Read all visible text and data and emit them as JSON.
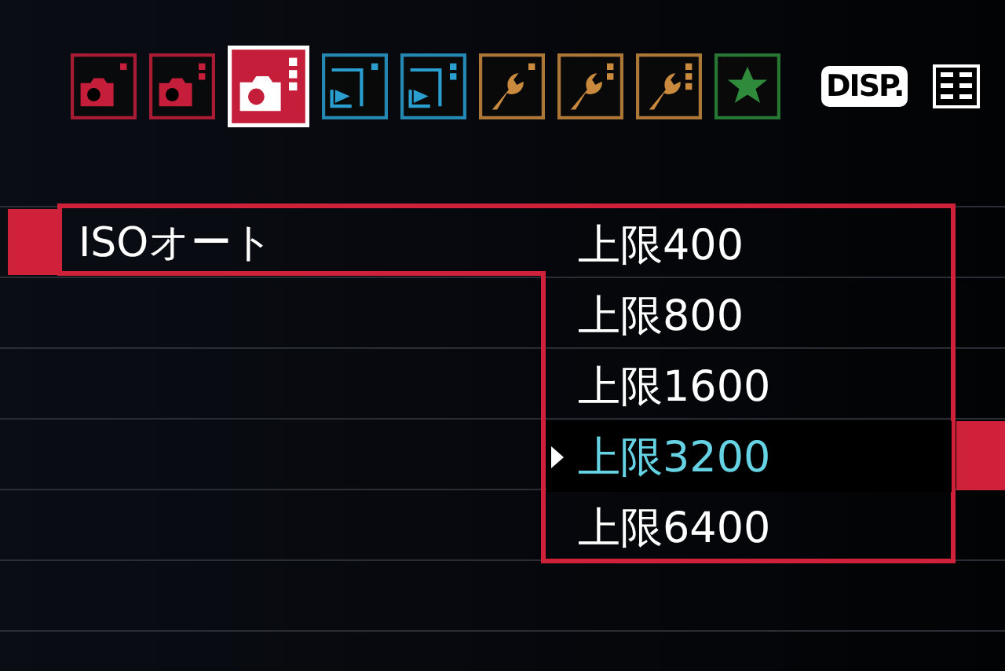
{
  "tabs": [
    {
      "kind": "shoot",
      "selected": false
    },
    {
      "kind": "shoot",
      "selected": false
    },
    {
      "kind": "shoot",
      "selected": true
    },
    {
      "kind": "play",
      "selected": false
    },
    {
      "kind": "play",
      "selected": false
    },
    {
      "kind": "setup",
      "selected": false
    },
    {
      "kind": "setup",
      "selected": false
    },
    {
      "kind": "setup",
      "selected": false
    },
    {
      "kind": "mymenu",
      "selected": false
    }
  ],
  "disp_button": {
    "label": "DISP."
  },
  "menu": {
    "item": {
      "label": "ISOオート"
    },
    "options": [
      {
        "label": "上限400",
        "selected": false
      },
      {
        "label": "上限800",
        "selected": false
      },
      {
        "label": "上限1600",
        "selected": false
      },
      {
        "label": "上限3200",
        "selected": true
      },
      {
        "label": "上限6400",
        "selected": false
      }
    ]
  }
}
